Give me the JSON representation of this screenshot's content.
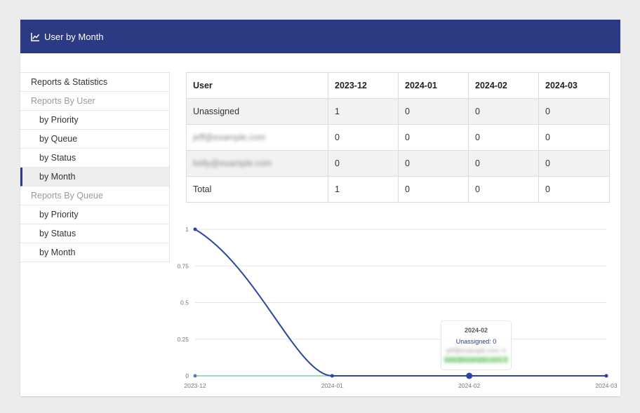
{
  "header": {
    "title": "User by Month",
    "icon": "line-chart-icon"
  },
  "sidebar": {
    "items": [
      {
        "label": "Reports & Statistics",
        "kind": "top"
      },
      {
        "label": "Reports By User",
        "kind": "group"
      },
      {
        "label": "by Priority",
        "kind": "sub"
      },
      {
        "label": "by Queue",
        "kind": "sub"
      },
      {
        "label": "by Status",
        "kind": "sub"
      },
      {
        "label": "by Month",
        "kind": "sub",
        "active": true
      },
      {
        "label": "Reports By Queue",
        "kind": "group"
      },
      {
        "label": "by Priority",
        "kind": "sub"
      },
      {
        "label": "by Status",
        "kind": "sub"
      },
      {
        "label": "by Month",
        "kind": "sub"
      }
    ]
  },
  "table": {
    "headers": [
      "User",
      "2023-12",
      "2024-01",
      "2024-02",
      "2024-03"
    ],
    "rows": [
      {
        "cells": [
          "Unassigned",
          "1",
          "0",
          "0",
          "0"
        ],
        "blurred": false
      },
      {
        "cells": [
          "jeff@example.com",
          "0",
          "0",
          "0",
          "0"
        ],
        "blurred": true
      },
      {
        "cells": [
          "kelly@example.com",
          "0",
          "0",
          "0",
          "0"
        ],
        "blurred": true
      },
      {
        "cells": [
          "Total",
          "1",
          "0",
          "0",
          "0"
        ],
        "blurred": false
      }
    ]
  },
  "chart_data": {
    "type": "line",
    "x": [
      "2023-12",
      "2024-01",
      "2024-02",
      "2024-03"
    ],
    "yticks": [
      "0",
      "0.25",
      "0.5",
      "0.75",
      "1"
    ],
    "ylim": [
      0,
      1
    ],
    "grid": true,
    "series": [
      {
        "name": "Unassigned",
        "values": [
          1,
          0,
          0,
          0
        ],
        "color": "#2b45a0"
      },
      {
        "name": "",
        "values": [
          0,
          0,
          0,
          0
        ],
        "color": "#7fd0a0"
      }
    ],
    "tooltip": {
      "title": "2024-02",
      "line1": "Unassigned: 0",
      "line2": "jeff@example.com: 0",
      "line3": "kelly@example.com: 0"
    }
  }
}
